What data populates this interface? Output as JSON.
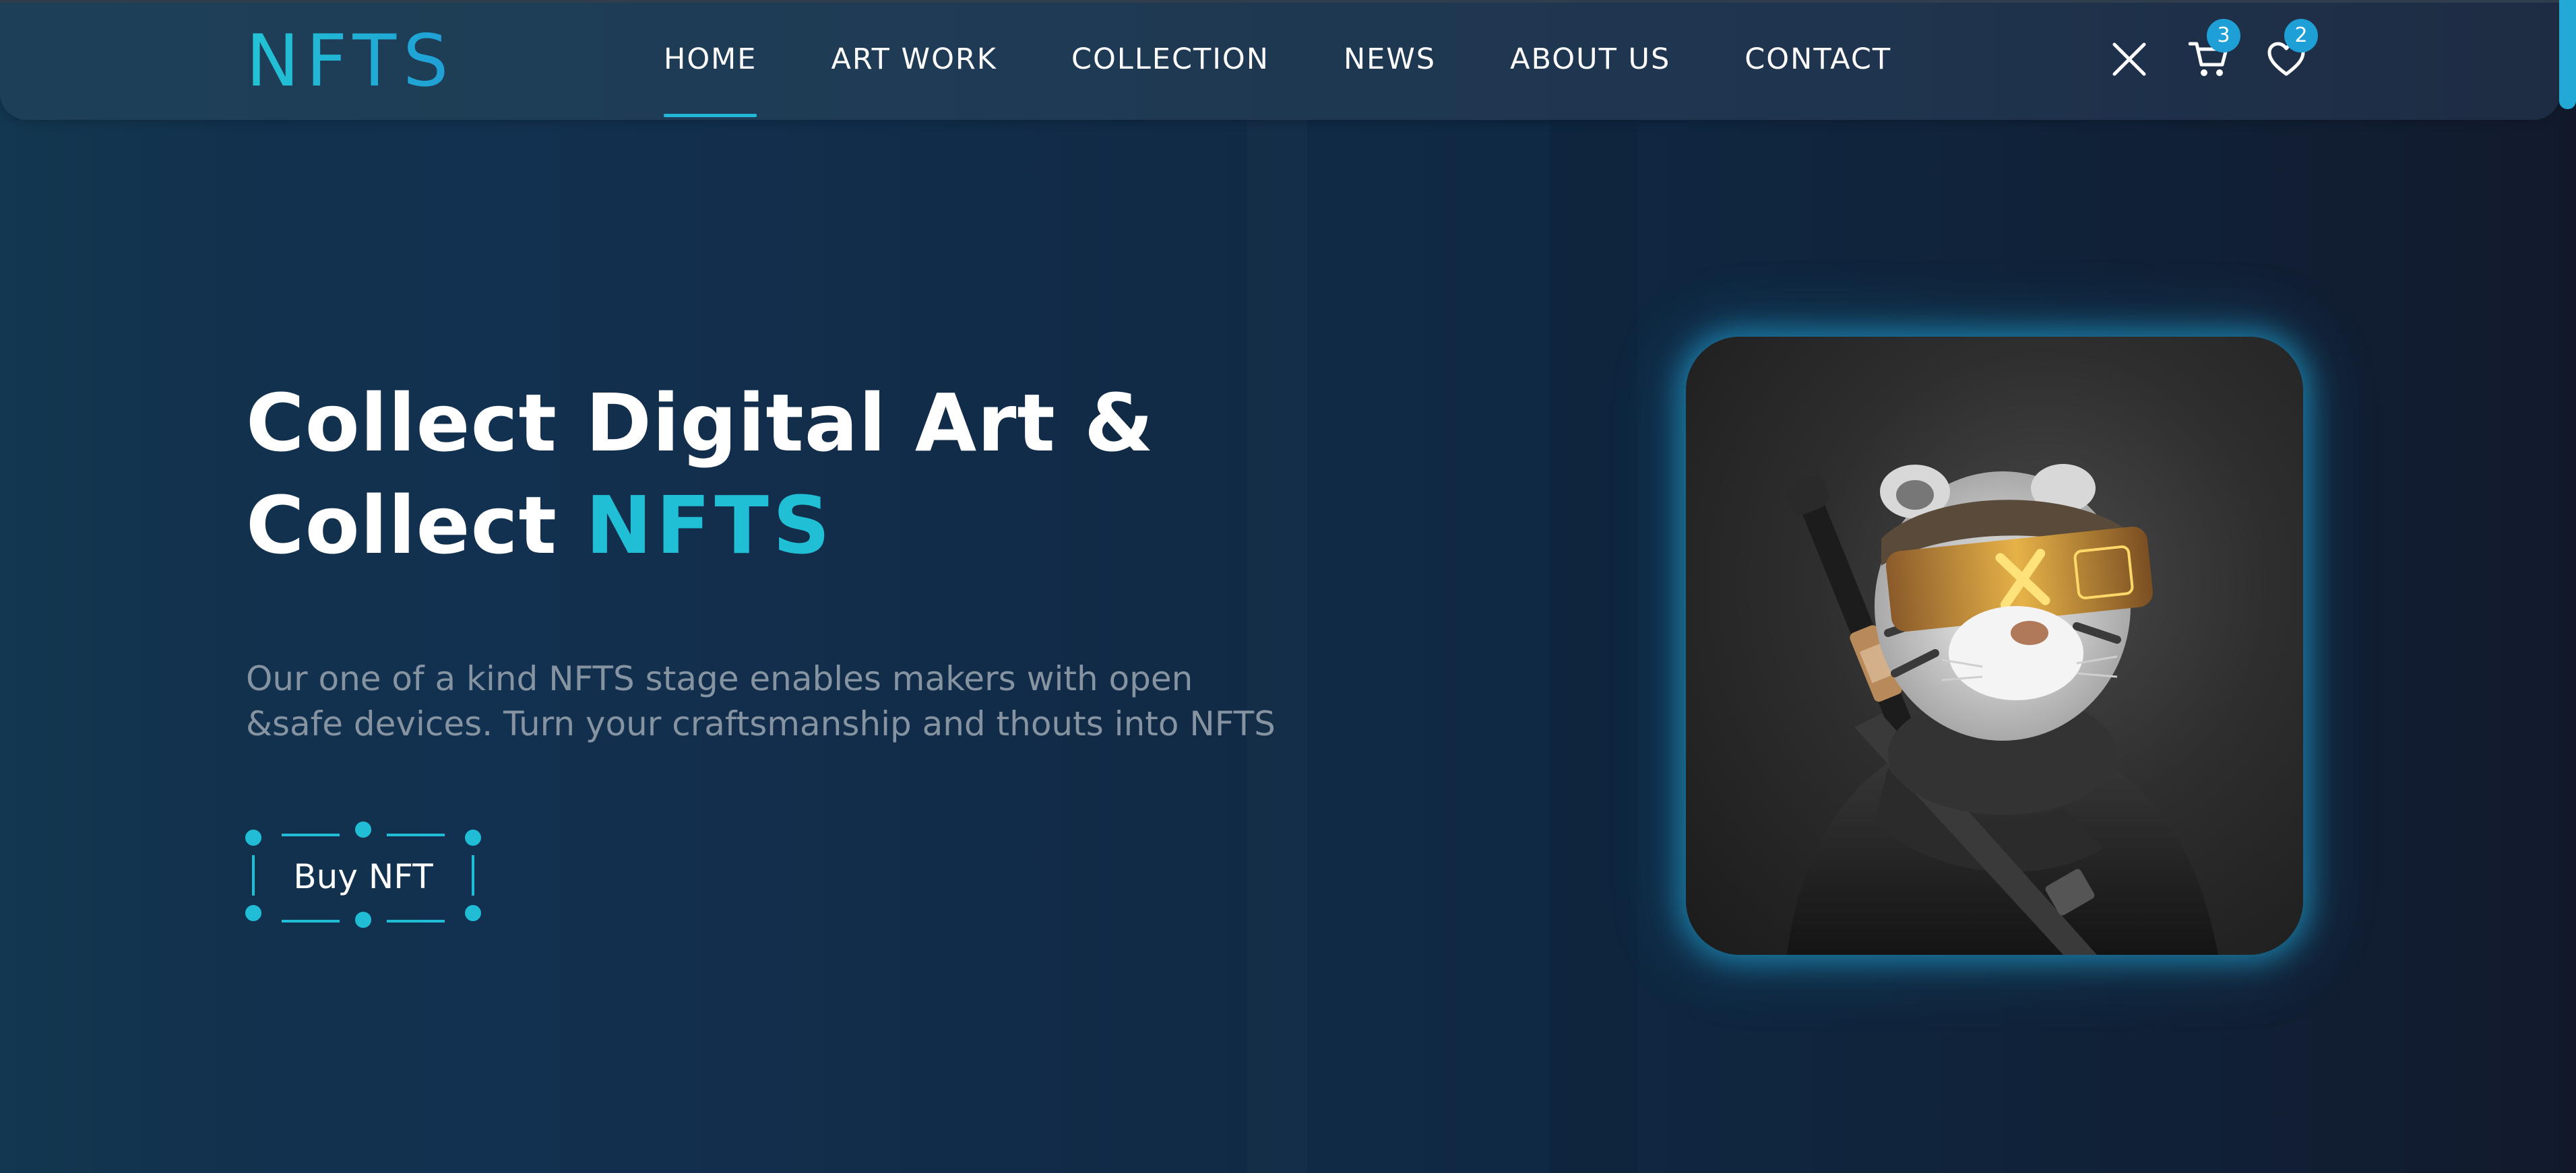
{
  "logo": "NFTS",
  "nav": {
    "items": [
      {
        "label": "HOME",
        "active": true
      },
      {
        "label": "ART WORK",
        "active": false
      },
      {
        "label": "COLLECTION",
        "active": false
      },
      {
        "label": "NEWS",
        "active": false
      },
      {
        "label": "ABOUT US",
        "active": false
      },
      {
        "label": "CONTACT",
        "active": false
      }
    ]
  },
  "header_icons": {
    "close": {
      "icon": "close-icon"
    },
    "cart": {
      "icon": "cart-icon",
      "count": "3"
    },
    "wishlist": {
      "icon": "heart-icon",
      "count": "2"
    }
  },
  "hero": {
    "title_line1": "Collect Digital Art &",
    "title_line2_prefix": "Collect ",
    "title_line2_accent": "NFTS",
    "description_line1": "Our one of a kind NFTS stage enables makers with open",
    "description_line2": "&safe devices. Turn your craftsmanship and thouts into NFTS",
    "cta_label": "Buy NFT"
  },
  "colors": {
    "accent": "#20bfd6",
    "badge": "#1e9fd6",
    "text": "#ffffff",
    "muted": "#8693a1"
  },
  "hero_image": {
    "subject": "armored white tiger with gold visor goggles"
  }
}
